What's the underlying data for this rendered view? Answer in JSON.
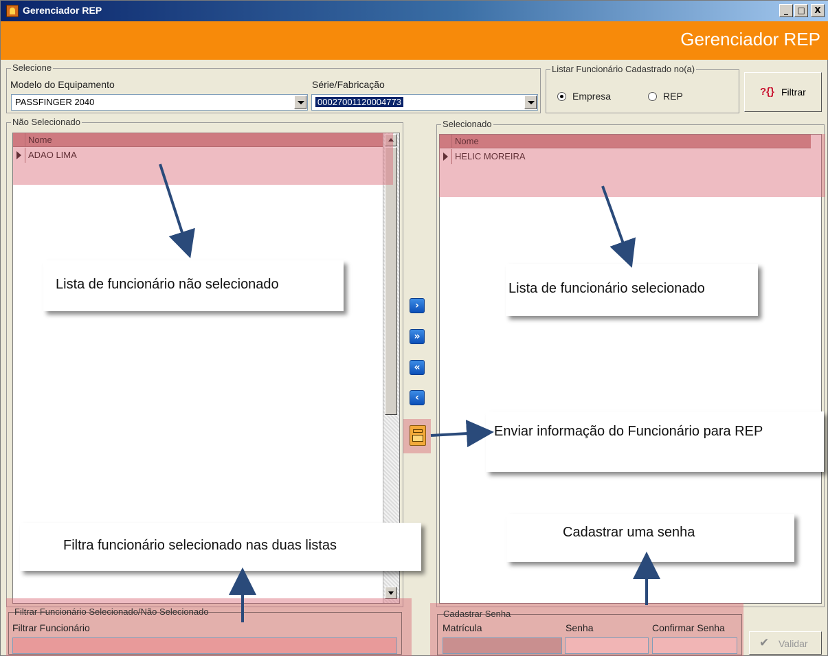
{
  "window": {
    "title": "Gerenciador REP",
    "header_title": "Gerenciador REP",
    "minimize": "_",
    "maximize": "□",
    "close": "X"
  },
  "select_group": {
    "legend": "Selecione",
    "model_label": "Modelo do Equipamento",
    "model_value": "PASSFINGER 2040",
    "serial_label": "Série/Fabricação",
    "serial_value": "00027001120004773"
  },
  "list_group": {
    "legend": "Listar Funcionário Cadastrado no(a)",
    "options": [
      "Empresa",
      "REP"
    ],
    "selected": "Empresa"
  },
  "filter_button": {
    "icon": "?{}",
    "label": "Filtrar"
  },
  "not_selected": {
    "legend": "Não Selecionado",
    "column": "Nome",
    "rows": [
      "ADAO LIMA"
    ]
  },
  "selected": {
    "legend": "Selecionado",
    "column": "Nome",
    "rows": [
      "HELIC  MOREIRA"
    ]
  },
  "move_buttons": {
    "move_one": "›",
    "move_all": "»",
    "remove_all": "«",
    "remove_one": "‹"
  },
  "filter_group": {
    "legend": "Filtrar Funcionário Selecionado/Não Selecionado",
    "field_label": "Filtrar Funcionário"
  },
  "password_group": {
    "legend": "Cadastrar Senha",
    "matricula_label": "Matrícula",
    "senha_label": "Senha",
    "confirm_label": "Confirmar Senha"
  },
  "validate_button": {
    "label": "Validar"
  },
  "callouts": {
    "not_selected_list": "Lista de funcionário não selecionado",
    "selected_list": "Lista de funcionário selecionado",
    "send_info": "Enviar informação do Funcionário para REP",
    "filter_info": "Filtra funcionário selecionado nas duas listas",
    "password_info": "Cadastrar uma senha"
  },
  "colors": {
    "header_orange": "#f78a0a",
    "highlight": "#da6a78",
    "arrow_blue": "#2a4a7a"
  }
}
